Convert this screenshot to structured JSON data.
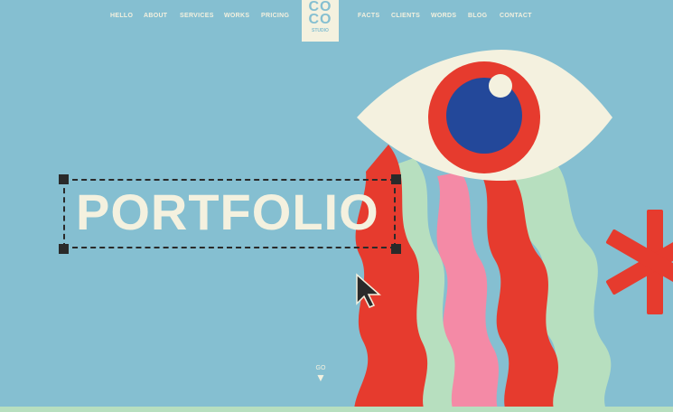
{
  "nav": {
    "left": [
      "HELLO",
      "ABOUT",
      "SERVICES",
      "WORKS",
      "PRICING"
    ],
    "right": [
      "FACTS",
      "CLIENTS",
      "WORDS",
      "BLOG",
      "CONTACT"
    ]
  },
  "logo": {
    "line1": "CO",
    "line2": "CO",
    "line3": "STUDIO"
  },
  "hero": {
    "title": "PORTFOLIO"
  },
  "scroll": {
    "label": "GO",
    "arrow": "▼"
  },
  "colors": {
    "background": "#85bfd1",
    "cream": "#f4f1df",
    "red": "#e63b2e",
    "pink": "#f48aa6",
    "mint": "#b7dfbf",
    "blue": "#23489a"
  }
}
